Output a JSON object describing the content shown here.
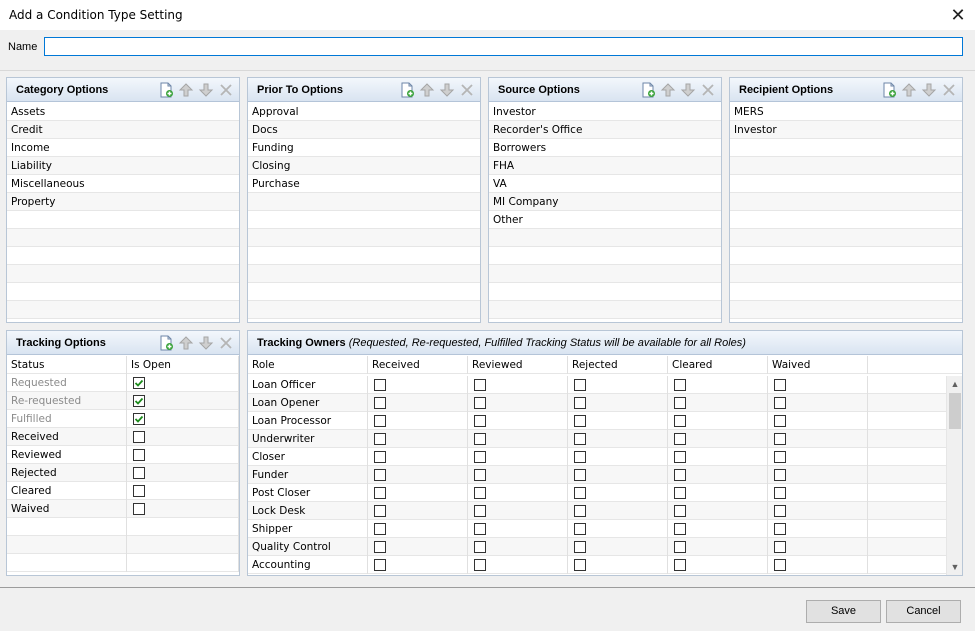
{
  "window": {
    "title": "Add a Condition Type Setting",
    "close": "✕"
  },
  "name_field": {
    "label": "Name",
    "value": ""
  },
  "panels": {
    "category": {
      "title": "Category Options",
      "items": [
        "Assets",
        "Credit",
        "Income",
        "Liability",
        "Miscellaneous",
        "Property"
      ]
    },
    "prior_to": {
      "title": "Prior To Options",
      "items": [
        "Approval",
        "Docs",
        "Funding",
        "Closing",
        "Purchase"
      ]
    },
    "source": {
      "title": "Source Options",
      "items": [
        "Investor",
        "Recorder's Office",
        "Borrowers",
        "FHA",
        "VA",
        "MI Company",
        "Other"
      ]
    },
    "recipient": {
      "title": "Recipient Options",
      "items": [
        "MERS",
        "Investor"
      ]
    }
  },
  "tracking": {
    "title": "Tracking Options",
    "columns": [
      "Status",
      "Is Open"
    ],
    "rows": [
      {
        "status": "Requested",
        "open": true,
        "muted": true
      },
      {
        "status": "Re-requested",
        "open": true,
        "muted": true
      },
      {
        "status": "Fulfilled",
        "open": true,
        "muted": true
      },
      {
        "status": "Received",
        "open": false,
        "muted": false
      },
      {
        "status": "Reviewed",
        "open": false,
        "muted": false
      },
      {
        "status": "Rejected",
        "open": false,
        "muted": false
      },
      {
        "status": "Cleared",
        "open": false,
        "muted": false
      },
      {
        "status": "Waived",
        "open": false,
        "muted": false
      }
    ]
  },
  "owners": {
    "title": "Tracking Owners",
    "subtitle": "(Requested, Re-requested, Fulfilled Tracking Status will be available for all Roles)",
    "columns": [
      "Role",
      "Received",
      "Reviewed",
      "Rejected",
      "Cleared",
      "Waived"
    ],
    "roles": [
      "Loan Officer",
      "Loan Opener",
      "Loan Processor",
      "Underwriter",
      "Closer",
      "Funder",
      "Post Closer",
      "Lock Desk",
      "Shipper",
      "Quality Control",
      "Accounting"
    ]
  },
  "buttons": {
    "save": "Save",
    "cancel": "Cancel"
  },
  "icons": {
    "add": "add-document-icon",
    "up": "arrow-up-icon",
    "down": "arrow-down-icon",
    "delete": "delete-x-icon"
  }
}
